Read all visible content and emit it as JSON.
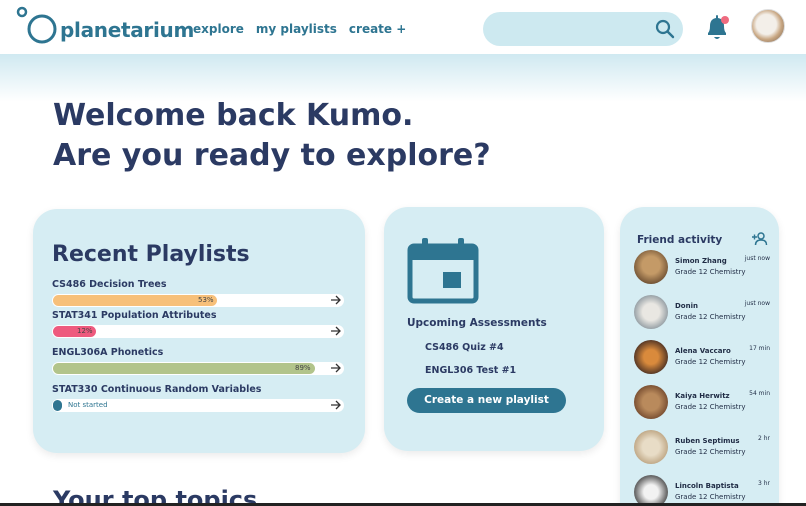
{
  "header": {
    "logo_text": "planetarium",
    "nav": [
      {
        "label": "explore"
      },
      {
        "label": "my playlists"
      },
      {
        "label": "create +"
      }
    ],
    "search_placeholder": ""
  },
  "welcome": {
    "line1": "Welcome back Kumo.",
    "line2": "Are you ready to explore?"
  },
  "playlists": {
    "title": "Recent Playlists",
    "items": [
      {
        "name": "CS486 Decision Trees",
        "progress": 0.53,
        "label": "53%",
        "color": "#f7c07a"
      },
      {
        "name": "STAT341 Population Attributes",
        "progress": 0.12,
        "label": "12%",
        "color": "#ee5a7e"
      },
      {
        "name": "ENGL306A Phonetics",
        "progress": 0.89,
        "label": "89%",
        "color": "#b2c48b"
      },
      {
        "name": "STAT330 Continuous Random Variables",
        "progress": 0,
        "label": "Not started",
        "color": "#2e7591"
      }
    ]
  },
  "assessments": {
    "title": "Upcoming Assessments",
    "items": [
      "CS486 Quiz #4",
      "ENGL306 Test #1"
    ],
    "button": "Create a new playlist"
  },
  "friends": {
    "title": "Friend activity",
    "items": [
      {
        "name": "Simon Zhang",
        "sub": "Grade 12 Chemistry",
        "time": "just now"
      },
      {
        "name": "Donin",
        "sub": "Grade 12 Chemistry",
        "time": "just now"
      },
      {
        "name": "Alena Vaccaro",
        "sub": "Grade 12 Chemistry",
        "time": "17 min"
      },
      {
        "name": "Kaiya Herwitz",
        "sub": "Grade 12 Chemistry",
        "time": "54 min"
      },
      {
        "name": "Ruben Septimus",
        "sub": "Grade 12 Chemistry",
        "time": "2 hr"
      },
      {
        "name": "Lincoln Baptista",
        "sub": "Grade 12 Chemistry",
        "time": "3 hr"
      }
    ]
  },
  "topics": {
    "title": "Your top topics"
  },
  "colors": {
    "brand": "#2e7591",
    "heading": "#2b3a63",
    "card": "#d6edf3",
    "notification": "#ee6b7f"
  },
  "icons": [
    "logo-mark",
    "search-icon",
    "bell-icon",
    "arrow-right-icon",
    "calendar-icon",
    "add-friend-icon"
  ]
}
